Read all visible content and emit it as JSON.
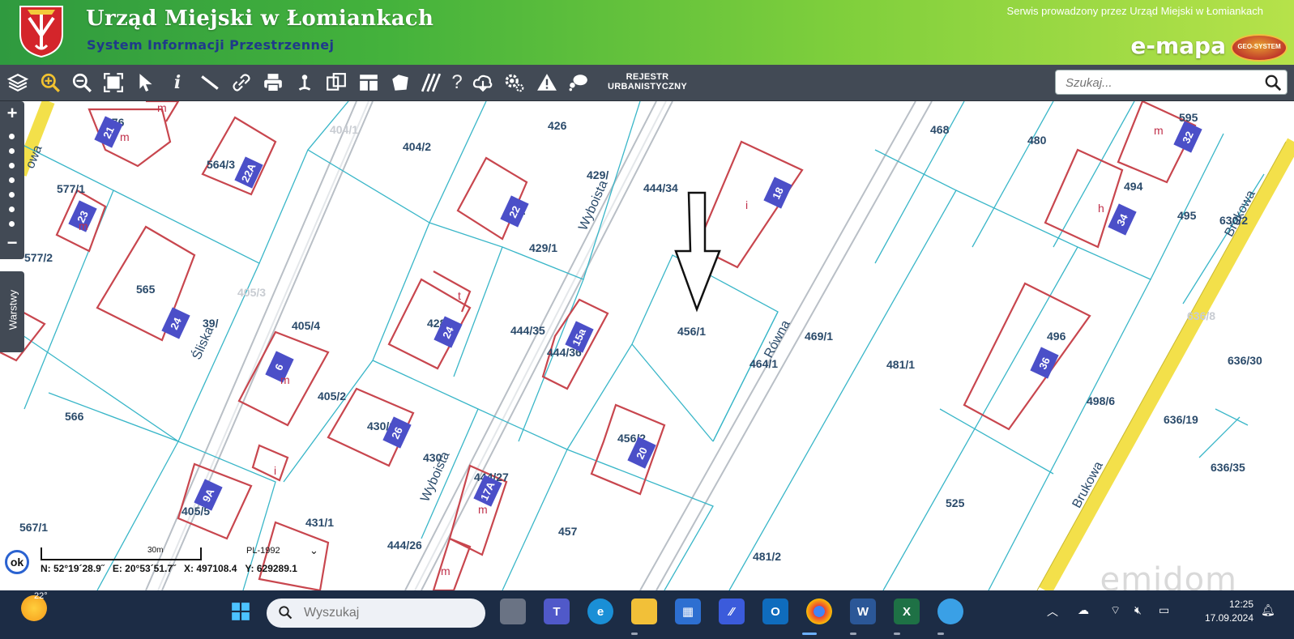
{
  "header": {
    "title": "Urząd Miejski w Łomiankach",
    "subtitle": "System Informacji Przestrzennej",
    "service_note": "Serwis prowadzony przez Urząd Miejski w Łomiankach",
    "brand": "e-mapa",
    "brand_badge": "GEO-SYSTEM"
  },
  "toolbar": {
    "tools": [
      "layers-icon",
      "zoom-in-icon",
      "zoom-out-icon",
      "full-extent-icon",
      "select-pointer-icon",
      "info-icon",
      "measure-icon",
      "link-icon",
      "print-icon",
      "locate-icon",
      "compare-icon",
      "layout-icon",
      "shape-icon",
      "hatch-icon",
      "help-icon",
      "download-icon",
      "settings-icon",
      "warning-icon",
      "chat-icon"
    ],
    "rejestr_line1": "REJESTR",
    "rejestr_line2": "URBANISTYCZNY",
    "search_placeholder": "Szukaj..."
  },
  "map": {
    "parcels": [
      "576",
      "577/1",
      "577/2",
      "564/3",
      "565",
      "566",
      "567/1",
      "404/1",
      "404/2",
      "405/3",
      "405/4",
      "405/2",
      "405/5",
      "431/1",
      "426",
      "429/1",
      "430/1",
      "430",
      "444/34",
      "444/35",
      "444/36",
      "444/27",
      "444/26",
      "456/1",
      "456/2",
      "457",
      "468",
      "469/1",
      "481/1",
      "481/2",
      "480",
      "494",
      "495",
      "496",
      "498/6",
      "525",
      "595",
      "630/2",
      "636/8",
      "636/30",
      "636/19",
      "636/35",
      "39/",
      "429/",
      "42",
      "428",
      "464/1"
    ],
    "house_numbers": [
      "21",
      "23",
      "22A",
      "24",
      "9A",
      "6",
      "26",
      "24",
      "22",
      "15a",
      "17A",
      "18",
      "20",
      "34",
      "36",
      "32"
    ],
    "streets": [
      "Śliska",
      "Wyboista",
      "Wyboista",
      "Równa",
      "Brukowa",
      "Brukowa",
      "owa"
    ],
    "markers": [
      "m",
      "m",
      "m",
      "m",
      "m",
      "m",
      "i",
      "i",
      "t",
      "h",
      "m"
    ],
    "layers_tab": "Warstwy",
    "arrow": "down-arrow-marker"
  },
  "status": {
    "ok": "ok",
    "scale": "30m",
    "crs": "PL-1992",
    "lat": "N: 52°19´28.9˝",
    "lon": "E: 20°53´51.7˝",
    "x": "X: 497108.4",
    "y": "Y: 629289.1"
  },
  "taskbar": {
    "temperature": "22°",
    "search_placeholder": "Wyszukaj",
    "apps": [
      "task-view-icon",
      "teams-icon",
      "edge-icon",
      "file-explorer-icon",
      "store-icon",
      "app-icon",
      "outlook-icon",
      "chrome-icon",
      "word-icon",
      "excel-icon",
      "paint-icon"
    ],
    "time": "12:25",
    "date": "17.09.2024"
  },
  "watermark": "emidom"
}
